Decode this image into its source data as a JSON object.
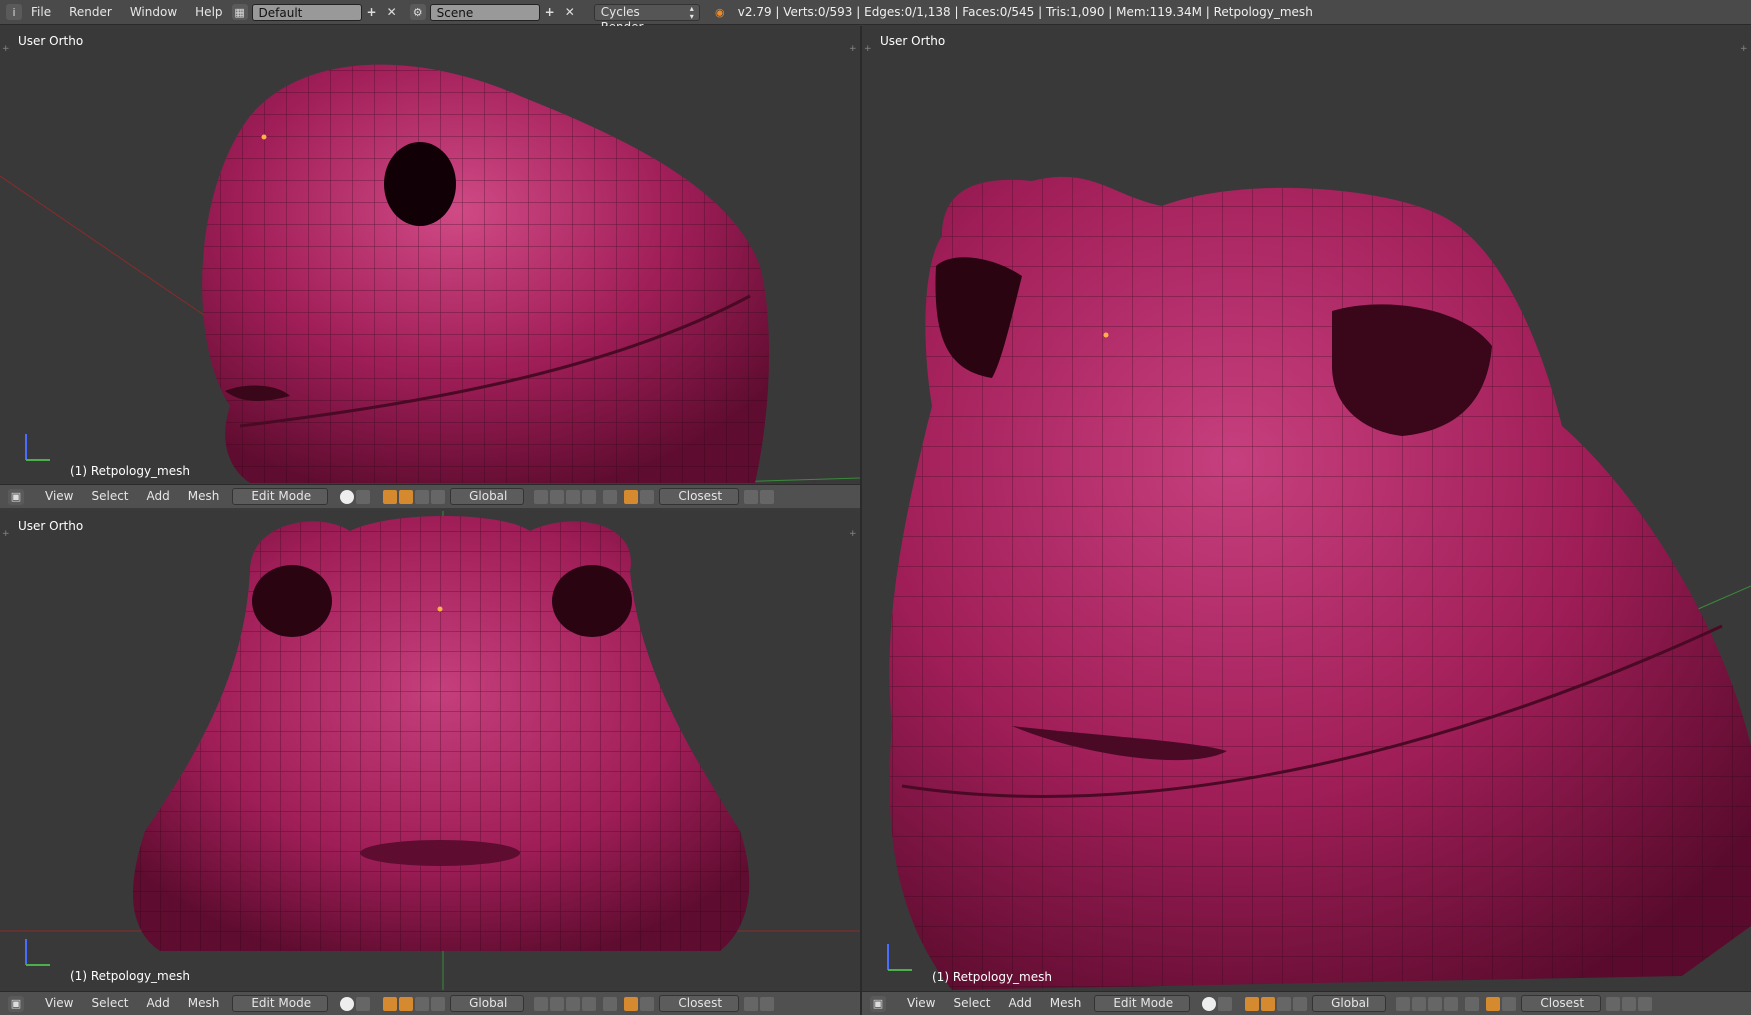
{
  "topbar": {
    "menus": [
      "File",
      "Render",
      "Window",
      "Help"
    ],
    "layout_value": "Default",
    "scene_value": "Scene",
    "engine": "Cycles Render",
    "stats": "v2.79 | Verts:0/593 | Edges:0/1,138 | Faces:0/545 | Tris:1,090 | Mem:119.34M | Retpology_mesh"
  },
  "viewports": {
    "top_left": {
      "label": "User Ortho",
      "object": "(1) Retpology_mesh"
    },
    "bottom_left": {
      "label": "User Ortho",
      "object": "(1) Retpology_mesh"
    },
    "right": {
      "label": "User Ortho",
      "object": "(1) Retpology_mesh"
    }
  },
  "header": {
    "view": "View",
    "select": "Select",
    "add": "Add",
    "mesh": "Mesh",
    "mode": "Edit Mode",
    "orientation": "Global",
    "snap": "Closest"
  },
  "colors": {
    "mesh": "#a01e58",
    "mesh_light": "#d04a86",
    "mesh_dark": "#5e0c2f",
    "viewport_bg": "#393939"
  },
  "icons": [
    "info-icon",
    "screen-layout-icon",
    "scene-icon",
    "blender-icon",
    "cube-icon",
    "pivot-icon",
    "snap-magnet-icon"
  ]
}
